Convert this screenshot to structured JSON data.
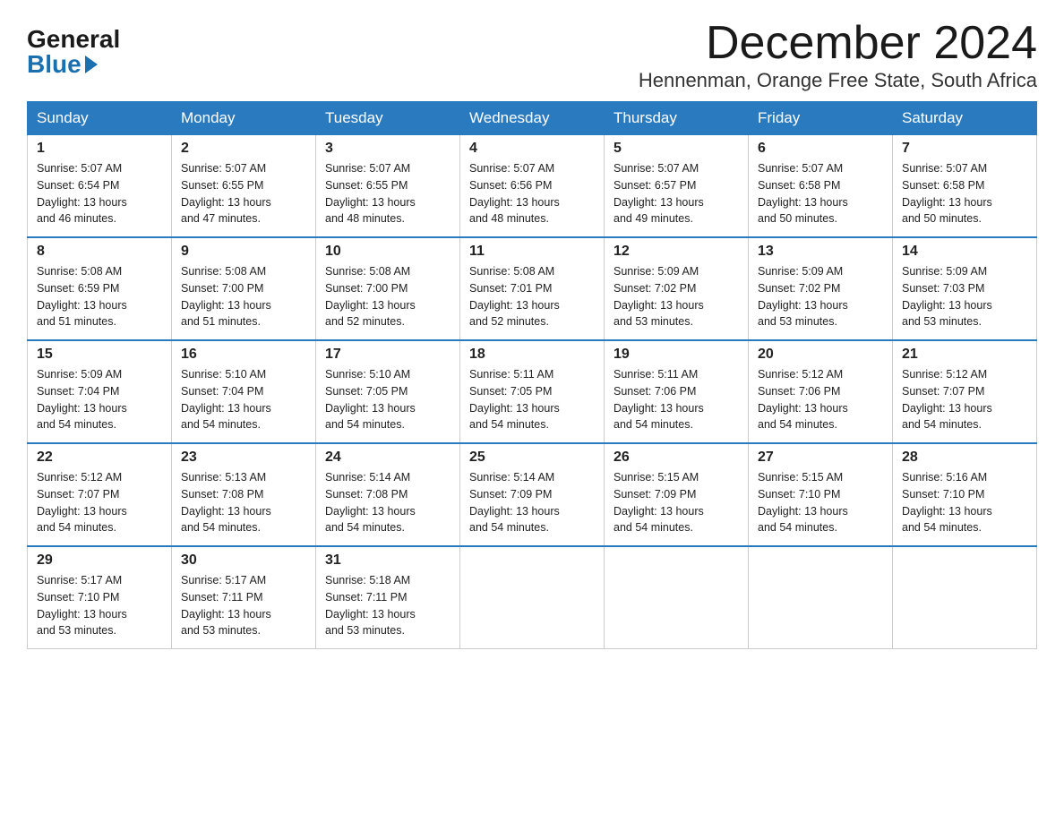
{
  "logo": {
    "general": "General",
    "blue": "Blue"
  },
  "title": "December 2024",
  "location": "Hennenman, Orange Free State, South Africa",
  "days_of_week": [
    "Sunday",
    "Monday",
    "Tuesday",
    "Wednesday",
    "Thursday",
    "Friday",
    "Saturday"
  ],
  "weeks": [
    [
      {
        "day": "1",
        "sunrise": "5:07 AM",
        "sunset": "6:54 PM",
        "daylight": "13 hours and 46 minutes."
      },
      {
        "day": "2",
        "sunrise": "5:07 AM",
        "sunset": "6:55 PM",
        "daylight": "13 hours and 47 minutes."
      },
      {
        "day": "3",
        "sunrise": "5:07 AM",
        "sunset": "6:55 PM",
        "daylight": "13 hours and 48 minutes."
      },
      {
        "day": "4",
        "sunrise": "5:07 AM",
        "sunset": "6:56 PM",
        "daylight": "13 hours and 48 minutes."
      },
      {
        "day": "5",
        "sunrise": "5:07 AM",
        "sunset": "6:57 PM",
        "daylight": "13 hours and 49 minutes."
      },
      {
        "day": "6",
        "sunrise": "5:07 AM",
        "sunset": "6:58 PM",
        "daylight": "13 hours and 50 minutes."
      },
      {
        "day": "7",
        "sunrise": "5:07 AM",
        "sunset": "6:58 PM",
        "daylight": "13 hours and 50 minutes."
      }
    ],
    [
      {
        "day": "8",
        "sunrise": "5:08 AM",
        "sunset": "6:59 PM",
        "daylight": "13 hours and 51 minutes."
      },
      {
        "day": "9",
        "sunrise": "5:08 AM",
        "sunset": "7:00 PM",
        "daylight": "13 hours and 51 minutes."
      },
      {
        "day": "10",
        "sunrise": "5:08 AM",
        "sunset": "7:00 PM",
        "daylight": "13 hours and 52 minutes."
      },
      {
        "day": "11",
        "sunrise": "5:08 AM",
        "sunset": "7:01 PM",
        "daylight": "13 hours and 52 minutes."
      },
      {
        "day": "12",
        "sunrise": "5:09 AM",
        "sunset": "7:02 PM",
        "daylight": "13 hours and 53 minutes."
      },
      {
        "day": "13",
        "sunrise": "5:09 AM",
        "sunset": "7:02 PM",
        "daylight": "13 hours and 53 minutes."
      },
      {
        "day": "14",
        "sunrise": "5:09 AM",
        "sunset": "7:03 PM",
        "daylight": "13 hours and 53 minutes."
      }
    ],
    [
      {
        "day": "15",
        "sunrise": "5:09 AM",
        "sunset": "7:04 PM",
        "daylight": "13 hours and 54 minutes."
      },
      {
        "day": "16",
        "sunrise": "5:10 AM",
        "sunset": "7:04 PM",
        "daylight": "13 hours and 54 minutes."
      },
      {
        "day": "17",
        "sunrise": "5:10 AM",
        "sunset": "7:05 PM",
        "daylight": "13 hours and 54 minutes."
      },
      {
        "day": "18",
        "sunrise": "5:11 AM",
        "sunset": "7:05 PM",
        "daylight": "13 hours and 54 minutes."
      },
      {
        "day": "19",
        "sunrise": "5:11 AM",
        "sunset": "7:06 PM",
        "daylight": "13 hours and 54 minutes."
      },
      {
        "day": "20",
        "sunrise": "5:12 AM",
        "sunset": "7:06 PM",
        "daylight": "13 hours and 54 minutes."
      },
      {
        "day": "21",
        "sunrise": "5:12 AM",
        "sunset": "7:07 PM",
        "daylight": "13 hours and 54 minutes."
      }
    ],
    [
      {
        "day": "22",
        "sunrise": "5:12 AM",
        "sunset": "7:07 PM",
        "daylight": "13 hours and 54 minutes."
      },
      {
        "day": "23",
        "sunrise": "5:13 AM",
        "sunset": "7:08 PM",
        "daylight": "13 hours and 54 minutes."
      },
      {
        "day": "24",
        "sunrise": "5:14 AM",
        "sunset": "7:08 PM",
        "daylight": "13 hours and 54 minutes."
      },
      {
        "day": "25",
        "sunrise": "5:14 AM",
        "sunset": "7:09 PM",
        "daylight": "13 hours and 54 minutes."
      },
      {
        "day": "26",
        "sunrise": "5:15 AM",
        "sunset": "7:09 PM",
        "daylight": "13 hours and 54 minutes."
      },
      {
        "day": "27",
        "sunrise": "5:15 AM",
        "sunset": "7:10 PM",
        "daylight": "13 hours and 54 minutes."
      },
      {
        "day": "28",
        "sunrise": "5:16 AM",
        "sunset": "7:10 PM",
        "daylight": "13 hours and 54 minutes."
      }
    ],
    [
      {
        "day": "29",
        "sunrise": "5:17 AM",
        "sunset": "7:10 PM",
        "daylight": "13 hours and 53 minutes."
      },
      {
        "day": "30",
        "sunrise": "5:17 AM",
        "sunset": "7:11 PM",
        "daylight": "13 hours and 53 minutes."
      },
      {
        "day": "31",
        "sunrise": "5:18 AM",
        "sunset": "7:11 PM",
        "daylight": "13 hours and 53 minutes."
      },
      null,
      null,
      null,
      null
    ]
  ],
  "labels": {
    "sunrise": "Sunrise:",
    "sunset": "Sunset:",
    "daylight": "Daylight:"
  }
}
